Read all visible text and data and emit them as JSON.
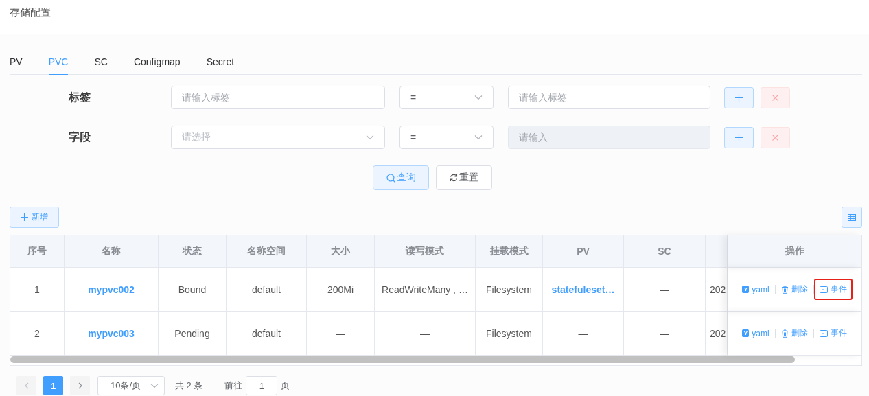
{
  "page_title": "存储配置",
  "tabs": [
    {
      "label": "PV",
      "selected": false
    },
    {
      "label": "PVC",
      "selected": true
    },
    {
      "label": "SC",
      "selected": false
    },
    {
      "label": "Configmap",
      "selected": false
    },
    {
      "label": "Secret",
      "selected": false
    }
  ],
  "filters": [
    {
      "label": "标签",
      "key_field": {
        "kind": "input",
        "placeholder": "请输入标签"
      },
      "operator": "=",
      "value_field": {
        "placeholder": "请输入标签",
        "disabled": false
      }
    },
    {
      "label": "字段",
      "key_field": {
        "kind": "select",
        "placeholder": "请选择"
      },
      "operator": "=",
      "value_field": {
        "placeholder": "请输入",
        "disabled": true
      }
    }
  ],
  "query_button": "查询",
  "reset_button": "重置",
  "add_button": "新增",
  "table": {
    "columns": [
      "序号",
      "名称",
      "状态",
      "名称空间",
      "大小",
      "读写模式",
      "挂载模式",
      "PV",
      "SC"
    ],
    "actions_header": "操作",
    "rows": [
      {
        "index": "1",
        "name": "mypvc002",
        "status": "Bound",
        "namespace": "default",
        "size": "200Mi",
        "access_modes": "ReadWriteMany , …",
        "volume_mode": "Filesystem",
        "pv": {
          "text": "statefuleset…",
          "link": true
        },
        "sc": "—",
        "column_10": "202",
        "actions": [
          {
            "kind": "yaml",
            "icon_text": "Y",
            "label": "yaml",
            "highlighted": false
          },
          {
            "kind": "delete",
            "label": "删除",
            "highlighted": false
          },
          {
            "kind": "events",
            "label": "事件",
            "highlighted": true
          }
        ]
      },
      {
        "index": "2",
        "name": "mypvc003",
        "status": "Pending",
        "namespace": "default",
        "size": "—",
        "access_modes": "—",
        "volume_mode": "Filesystem",
        "pv": {
          "text": "—",
          "link": false
        },
        "sc": "—",
        "column_10": "202",
        "actions": [
          {
            "kind": "yaml",
            "icon_text": "Y",
            "label": "yaml",
            "highlighted": false
          },
          {
            "kind": "delete",
            "label": "删除",
            "highlighted": false
          },
          {
            "kind": "events",
            "label": "事件",
            "highlighted": false
          }
        ]
      }
    ]
  },
  "pagination": {
    "pages": [
      {
        "label": "1",
        "selected": true
      }
    ],
    "prev_disabled": true,
    "next_disabled": false,
    "page_size": "10条/页",
    "total": "共 2 条",
    "goto_label": "前往",
    "goto_value": "1",
    "goto_suffix": "页"
  }
}
